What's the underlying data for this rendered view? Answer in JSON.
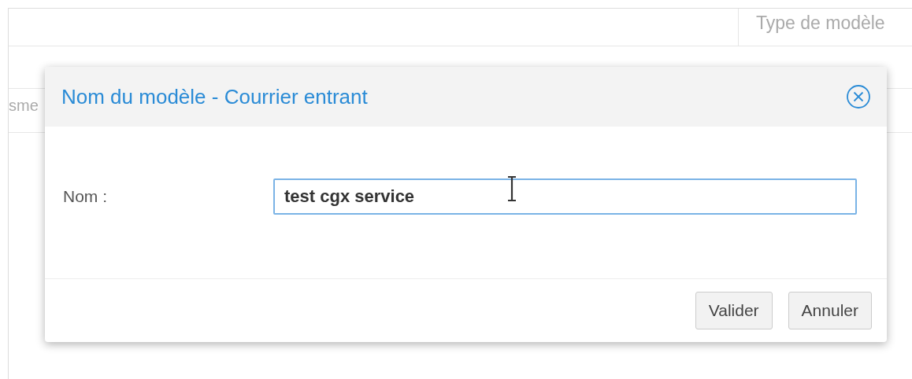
{
  "background_table": {
    "header": "Type de modèle",
    "row_text": "sme"
  },
  "dialog": {
    "title": "Nom du modèle - Courrier entrant",
    "fields": [
      {
        "label": "Nom :",
        "value": "test cgx service",
        "focused": true
      }
    ],
    "buttons": [
      "Valider",
      "Annuler"
    ]
  }
}
